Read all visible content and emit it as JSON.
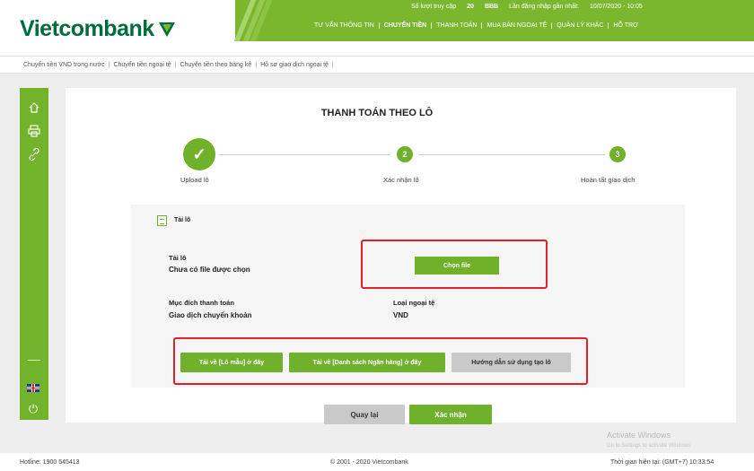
{
  "brand": {
    "name": "Vietcombank"
  },
  "topbar": {
    "visits_label": "Số lượt truy cập",
    "visits_value": "20",
    "user_code": "BBB",
    "last_login_label": "Lần đăng nhập gần nhất:",
    "last_login_value": "10/07/2020 - 10:05"
  },
  "main_nav": [
    "TƯ VẤN THÔNG TIN",
    "CHUYỂN TIỀN",
    "THANH TOÁN",
    "MUA BÁN NGOẠI TỆ",
    "QUẢN LÝ KHÁC",
    "HỖ TRỢ"
  ],
  "sub_nav": [
    "Chuyển tiền VND trong nước",
    "Chuyển tiền ngoại tệ",
    "Chuyển tiền theo bảng kê",
    "Hồ sơ giao dịch ngoại tệ"
  ],
  "page": {
    "title": "THANH TOÁN THEO LÔ"
  },
  "steps": [
    {
      "number": "✓",
      "label": "Upload lô"
    },
    {
      "number": "2",
      "label": "Xác nhận lô"
    },
    {
      "number": "3",
      "label": "Hoàn tất giao dịch"
    }
  ],
  "upload": {
    "section_title": "Tải lô",
    "file_label": "Tải lô",
    "file_status": "Chưa có file được chọn",
    "choose_file_button": "Chọn file",
    "purpose_label": "Mục đích thanh toán",
    "purpose_value": "Giao dịch chuyển khoản",
    "currency_label": "Loại ngoại tệ",
    "currency_value": "VND",
    "download_template_button": "Tải về [Lô mẫu] ở đây",
    "download_banks_button": "Tải về [Danh sách Ngân hàng] ở đây",
    "guide_button": "Hướng dẫn sử dụng tạo lô"
  },
  "actions": {
    "back_button": "Quay lại",
    "confirm_button": "Xác nhận"
  },
  "footer": {
    "hotline": "Hotline: 1900 545413",
    "copyright": "© 2001 - 2020 Vietcombank",
    "current_time": "Thời gian hiện tại: (GMT+7) 10:33:54"
  },
  "watermark": {
    "line1": "Activate Windows",
    "line2": "Go to Settings to activate Windows."
  },
  "colors": {
    "brand_green": "#006b3c",
    "accent_green": "#6fb12a",
    "highlight_red": "#e0202b"
  },
  "icons": {
    "sidebar": [
      "home-icon",
      "printer-icon",
      "link-icon"
    ],
    "language": "uk-flag-icon",
    "logout": "power-icon"
  }
}
